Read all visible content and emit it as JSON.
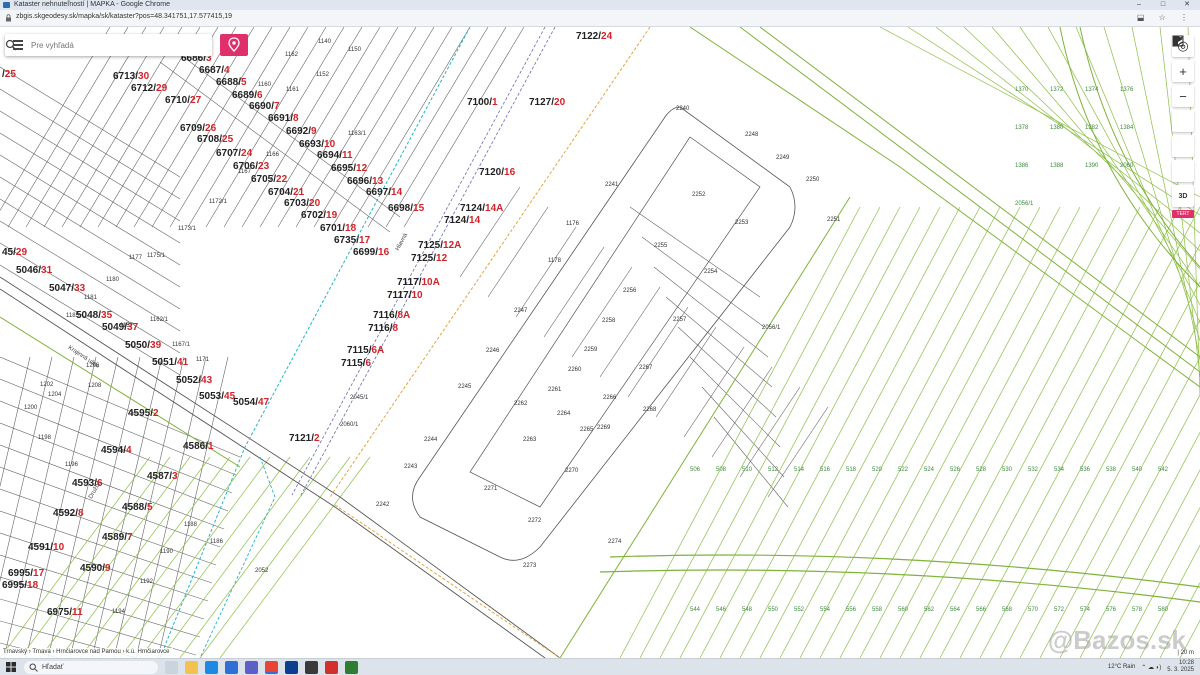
{
  "window": {
    "title": "Kataster nehnuteľností | MAPKA - Google Chrome",
    "controls": [
      "–",
      "□",
      "✕"
    ]
  },
  "address": {
    "url": "zbgis.skgeodesy.sk/mapka/sk/kataster?pos=48.341751,17.577415,19",
    "tools": "⬓ ☆ ⋮"
  },
  "search": {
    "placeholder": "Pre vyhľadá",
    "menu_icon": "hamburger-icon",
    "search_icon": "search-icon"
  },
  "controls": {
    "locate": "◎",
    "zoom_in": "+",
    "zoom_out": "−",
    "view_3d": "3D",
    "badge": "TERT"
  },
  "colors": {
    "accent": "#e0306b",
    "parcel_line": "#555555",
    "green_line": "#7fb33a",
    "cyan_line": "#22b5c9",
    "orange_line": "#e8a33c",
    "house_red": "#d2232a"
  },
  "house_numbers": [
    {
      "black": "6713",
      "red": "30"
    },
    {
      "black": "6712",
      "red": "29"
    },
    {
      "black": "6710",
      "red": "27"
    },
    {
      "black": "6709",
      "red": "26"
    },
    {
      "black": "6708",
      "red": "25"
    },
    {
      "black": "6707",
      "red": "24"
    },
    {
      "black": "6706",
      "red": "23"
    },
    {
      "black": "6705",
      "red": "22"
    },
    {
      "black": "6704",
      "red": "21"
    },
    {
      "black": "6703",
      "red": "20"
    },
    {
      "black": "6702",
      "red": "19"
    },
    {
      "black": "6701",
      "red": "18"
    },
    {
      "black": "6735",
      "red": "17"
    },
    {
      "black": "6699",
      "red": "16"
    },
    {
      "black": "6698",
      "red": "15"
    },
    {
      "black": "6697",
      "red": "14"
    },
    {
      "black": "6696",
      "red": "13"
    },
    {
      "black": "6695",
      "red": "12"
    },
    {
      "black": "6694",
      "red": "11"
    },
    {
      "black": "6693",
      "red": "10"
    },
    {
      "black": "6692",
      "red": "9"
    },
    {
      "black": "6691",
      "red": "8"
    },
    {
      "black": "6690",
      "red": "7"
    },
    {
      "black": "6689",
      "red": "6"
    },
    {
      "black": "6688",
      "red": "5"
    },
    {
      "black": "6687",
      "red": "4"
    },
    {
      "black": "6686",
      "red": "3"
    },
    {
      "black": "7122",
      "red": "24"
    },
    {
      "black": "7127",
      "red": "20"
    },
    {
      "black": "7100",
      "red": "1"
    },
    {
      "black": "7120",
      "red": "16"
    },
    {
      "black": "7124",
      "red": "14A"
    },
    {
      "black": "7124",
      "red": "14"
    },
    {
      "black": "7125",
      "red": "12A"
    },
    {
      "black": "7125",
      "red": "12"
    },
    {
      "black": "7117",
      "red": "10A"
    },
    {
      "black": "7117",
      "red": "10"
    },
    {
      "black": "7116",
      "red": "8A"
    },
    {
      "black": "7116",
      "red": "8"
    },
    {
      "black": "7115",
      "red": "6A"
    },
    {
      "black": "7115",
      "red": "6"
    },
    {
      "black": "7121",
      "red": "2"
    },
    {
      "black": "5046",
      "red": "31"
    },
    {
      "black": "5047",
      "red": "33"
    },
    {
      "black": "5048",
      "red": "35"
    },
    {
      "black": "5049",
      "red": "37"
    },
    {
      "black": "5050",
      "red": "39"
    },
    {
      "black": "5051",
      "red": "41"
    },
    {
      "black": "5052",
      "red": "43"
    },
    {
      "black": "5053",
      "red": "45"
    },
    {
      "black": "5054",
      "red": "47"
    },
    {
      "black": "4595",
      "red": "2"
    },
    {
      "black": "4586",
      "red": "1"
    },
    {
      "black": "4594",
      "red": "4"
    },
    {
      "black": "4587",
      "red": "3"
    },
    {
      "black": "4593",
      "red": "6"
    },
    {
      "black": "4592",
      "red": "8"
    },
    {
      "black": "4588",
      "red": "5"
    },
    {
      "black": "4589",
      "red": "7"
    },
    {
      "black": "4591",
      "red": "10"
    },
    {
      "black": "4590",
      "red": "9"
    },
    {
      "black": "6995",
      "red": "17"
    },
    {
      "black": "6995",
      "red": "18"
    },
    {
      "black": "6975",
      "red": "11"
    },
    {
      "black": "45",
      "red": "29"
    },
    {
      "black": "",
      "red": "25"
    }
  ],
  "parcels": [
    "1140",
    "1162",
    "1150",
    "1152",
    "1160",
    "1161",
    "1163/1",
    "1166",
    "1167",
    "1172/1",
    "1173/1",
    "1175/1",
    "1177",
    "1180",
    "1181",
    "1185",
    "1186",
    "1188",
    "1190",
    "1192",
    "1194",
    "1196",
    "1198",
    "1200",
    "1202",
    "1204",
    "1206",
    "1208",
    "1157",
    "1162/1",
    "1167/1",
    "1171",
    "1176",
    "1178",
    "2247",
    "2246",
    "2245",
    "2244",
    "2243",
    "2242",
    "2241",
    "2240",
    "2248",
    "2249",
    "2250",
    "2251",
    "2252",
    "2253",
    "2254",
    "2255",
    "2256",
    "2257",
    "2258",
    "2259",
    "2260",
    "2261",
    "2262",
    "2263",
    "2264",
    "2265",
    "2266",
    "2267",
    "2268",
    "2269",
    "2270",
    "2271",
    "2272",
    "2273",
    "2274",
    "2056/1",
    "2060/1",
    "2045/1",
    "2052"
  ],
  "green_parcels": [
    "506",
    "508",
    "510",
    "512",
    "514",
    "516",
    "518",
    "520",
    "522",
    "524",
    "526",
    "528",
    "530",
    "532",
    "534",
    "536",
    "538",
    "540",
    "542",
    "544",
    "546",
    "548",
    "550",
    "552",
    "554",
    "556",
    "558",
    "560",
    "562",
    "564",
    "566",
    "568",
    "570",
    "572",
    "574",
    "576",
    "578",
    "580",
    "1370",
    "1372",
    "1374",
    "1376",
    "1378",
    "1380",
    "1382",
    "1384",
    "1386",
    "1388",
    "1390",
    "2060",
    "2056/1"
  ],
  "streets": [
    {
      "name": "Krajinná ulica"
    },
    {
      "name": "Hlavná"
    },
    {
      "name": "Družba"
    }
  ],
  "breadcrumb": "Trnavský › Trnava › Hrnčiarovce nad Parnou › k.ú. Hrnčiarovce",
  "scale": "| 20 m",
  "watermark": "@Bazos.sk",
  "taskbar": {
    "search_label": "Hľadať",
    "weather": "12°C Rain",
    "time": "10:28",
    "date": "5. 3. 2025"
  }
}
